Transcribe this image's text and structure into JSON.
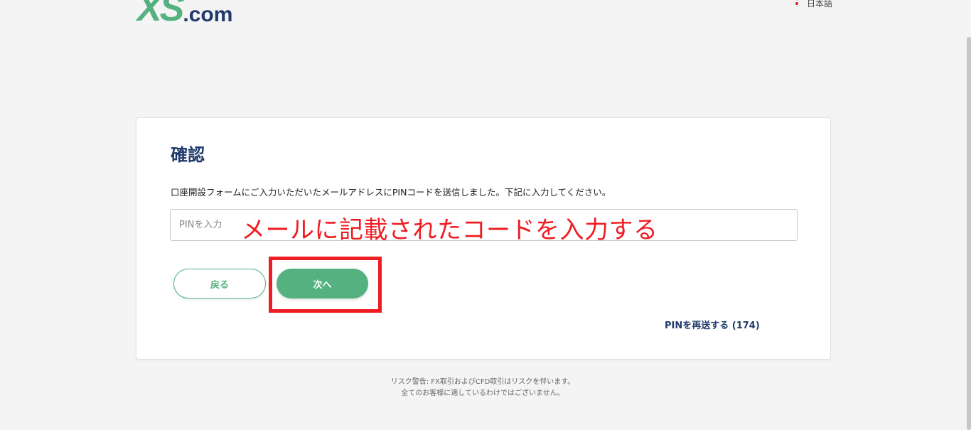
{
  "header": {
    "logo": {
      "main": "XS",
      "suffix": ".com"
    },
    "language": {
      "label": "日本語",
      "flag_icon": "japan-flag-icon"
    }
  },
  "card": {
    "title": "確認",
    "description": "口座開設フォームにご入力いただいたメールアドレスにPINコードを送信しました。下記に入力してください。",
    "pin_input": {
      "value": "",
      "placeholder": "PINを入力"
    },
    "back_button": "戻る",
    "next_button": "次へ",
    "resend_link": "PINを再送する (174)"
  },
  "annotation": {
    "text": "メールに記載されたコードを入力する",
    "color": "#ee1d23"
  },
  "footer": {
    "line1": "リスク警告: FX取引およびCFD取引はリスクを伴います。",
    "line2": "全てのお客様に適しているわけではございません。"
  },
  "colors": {
    "brand_green": "#55b17f",
    "brand_navy": "#1f3a6b",
    "background": "#f4f4f4"
  }
}
